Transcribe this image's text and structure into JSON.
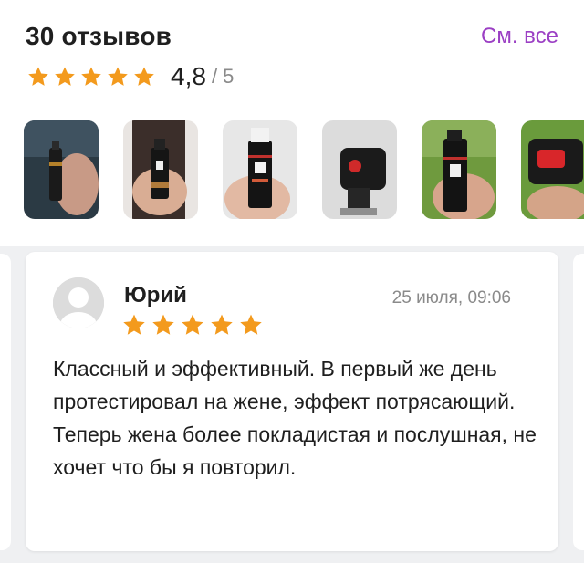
{
  "header": {
    "title": "30 отзывов",
    "see_all_label": "См. все"
  },
  "rating": {
    "stars": 5,
    "average": "4,8",
    "out_of": "/ 5",
    "star_color": "#f39a1d"
  },
  "photos": [
    {
      "icon": "spray-photo-1"
    },
    {
      "icon": "spray-photo-2"
    },
    {
      "icon": "spray-photo-3"
    },
    {
      "icon": "spray-photo-4"
    },
    {
      "icon": "spray-photo-5"
    },
    {
      "icon": "spray-photo-6"
    }
  ],
  "review": {
    "author": "Юрий",
    "date": "25 июля, 09:06",
    "stars": 5,
    "text": "Классный и эффективный. В первый же день протестировал на жене, эффект потрясающий.  Теперь жена более покладистая и послушная, не хочет что бы я повторил."
  },
  "colors": {
    "accent": "#9b3fc4",
    "star": "#f39a1d",
    "background_grey": "#eff0f2"
  }
}
